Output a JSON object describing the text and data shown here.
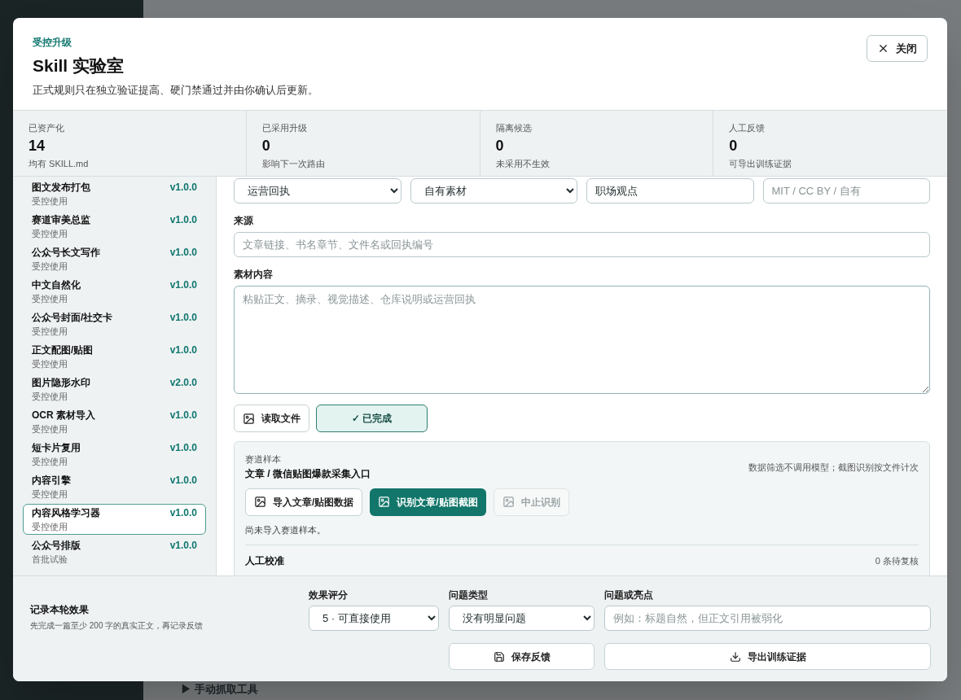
{
  "backdrop": {
    "tool_toggle": "▶ 手动抓取工具"
  },
  "header": {
    "eyebrow": "受控升级",
    "title": "Skill 实验室",
    "subtitle": "正式规则只在独立验证提高、硬门禁通过并由你确认后更新。",
    "close_button": "关闭"
  },
  "stats": [
    {
      "label": "已资产化",
      "value": "14",
      "note": "均有 SKILL.md"
    },
    {
      "label": "已采用升级",
      "value": "0",
      "note": "影响下一次路由"
    },
    {
      "label": "隔离候选",
      "value": "0",
      "note": "未采用不生效"
    },
    {
      "label": "人工反馈",
      "value": "0",
      "note": "可导出训练证据"
    }
  ],
  "sidebar": {
    "items": [
      {
        "name": "图文发布打包",
        "version": "v1.0.0",
        "status": "受控使用",
        "selected": false
      },
      {
        "name": "赛道审美总监",
        "version": "v1.0.0",
        "status": "受控使用",
        "selected": false
      },
      {
        "name": "公众号长文写作",
        "version": "v1.0.0",
        "status": "受控使用",
        "selected": false
      },
      {
        "name": "中文自然化",
        "version": "v1.0.0",
        "status": "受控使用",
        "selected": false
      },
      {
        "name": "公众号封面/社交卡",
        "version": "v1.0.0",
        "status": "受控使用",
        "selected": false
      },
      {
        "name": "正文配图/贴图",
        "version": "v1.0.0",
        "status": "受控使用",
        "selected": false
      },
      {
        "name": "图片隐形水印",
        "version": "v2.0.0",
        "status": "受控使用",
        "selected": false
      },
      {
        "name": "OCR 素材导入",
        "version": "v1.0.0",
        "status": "受控使用",
        "selected": false
      },
      {
        "name": "短卡片复用",
        "version": "v1.0.0",
        "status": "受控使用",
        "selected": false
      },
      {
        "name": "内容引擎",
        "version": "v1.0.0",
        "status": "受控使用",
        "selected": false
      },
      {
        "name": "内容风格学习器",
        "version": "v1.0.0",
        "status": "受控使用",
        "selected": true
      },
      {
        "name": "公众号排版",
        "version": "v1.0.0",
        "status": "首批试验",
        "selected": false
      }
    ]
  },
  "form": {
    "meta_fields": [
      {
        "kind": "select",
        "value": "运营回执"
      },
      {
        "kind": "select",
        "value": "自有素材"
      },
      {
        "kind": "text",
        "value": "职场观点"
      },
      {
        "kind": "text",
        "placeholder": "MIT / CC BY / 自有"
      }
    ],
    "source": {
      "label": "来源",
      "placeholder": "文章链接、书名章节、文件名或回执编号"
    },
    "content": {
      "label": "素材内容",
      "placeholder": "粘贴正文、摘录、视觉描述、仓库说明或运营回执"
    },
    "actions": [
      {
        "kind": "outline",
        "label": "读取文件"
      },
      {
        "kind": "done",
        "label": "✓ 已完成"
      }
    ]
  },
  "sample": {
    "eyebrow": "赛道样本",
    "title": "文章 / 微信贴图爆款采集入口",
    "note": "数据筛选不调用模型；截图识别按文件计次",
    "buttons": [
      {
        "kind": "outline",
        "label": "导入文章/贴图数据",
        "disabled": false
      },
      {
        "kind": "primary",
        "label": "识别文章/贴图截图",
        "disabled": false
      },
      {
        "kind": "outline",
        "label": "中止识别",
        "disabled": true
      }
    ],
    "status": "尚未导入赛道样本。",
    "review_title": "人工校准",
    "review_count": "0 条待复核"
  },
  "footer": {
    "title": "记录本轮效果",
    "note": "先完成一篇至少 200 字的真实正文，再记录反馈",
    "rating": {
      "label": "效果评分",
      "value": "5 · 可直接使用"
    },
    "issue": {
      "label": "问题类型",
      "value": "没有明显问题"
    },
    "comment": {
      "label": "问题或亮点",
      "placeholder": "例如：标题自然，但正文引用被弱化"
    },
    "save_button": "保存反馈",
    "export_button": "导出训练证据"
  }
}
